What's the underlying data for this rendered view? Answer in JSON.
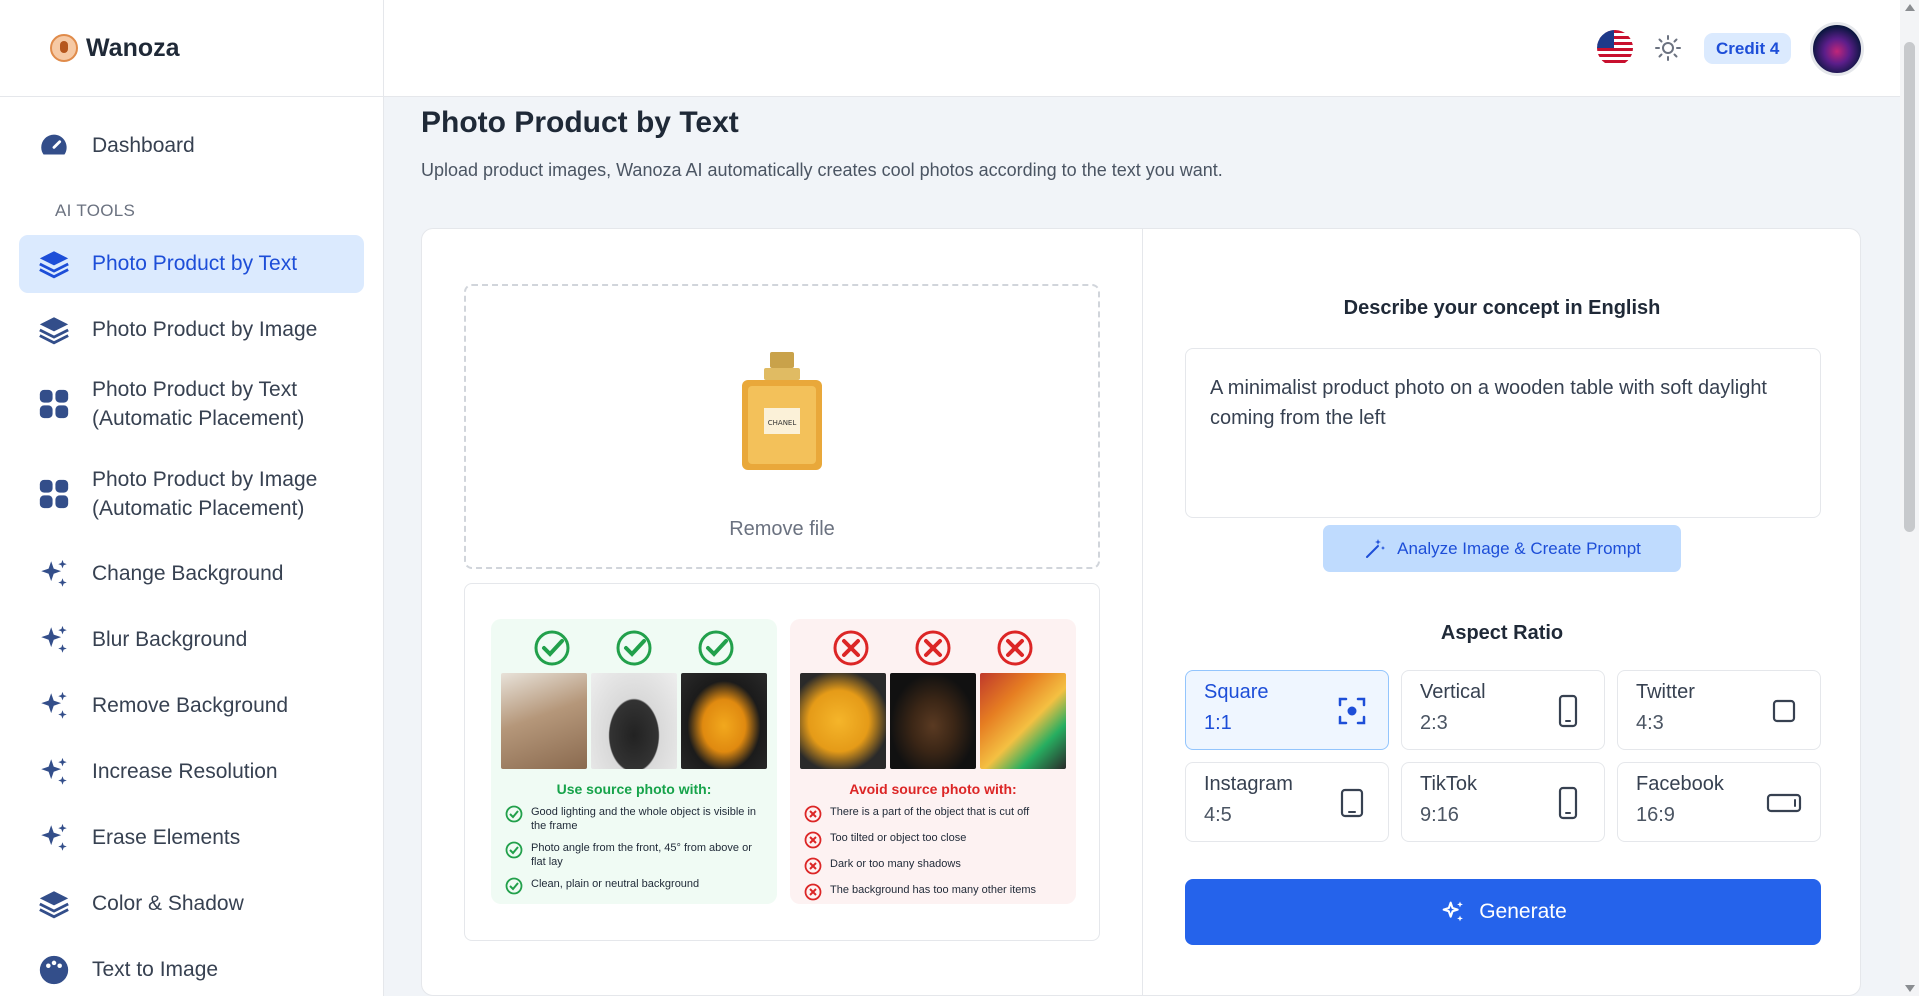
{
  "brand": {
    "name": "Wanoza"
  },
  "sidebar": {
    "dashboard_label": "Dashboard",
    "section_label": "AI TOOLS",
    "items": [
      {
        "label": "Photo Product by Text",
        "icon": "layers-icon"
      },
      {
        "label": "Photo Product by Image",
        "icon": "layers-icon"
      },
      {
        "label_line1": "Photo Product by Text",
        "label_line2": "(Automatic Placement)",
        "icon": "grid-icon"
      },
      {
        "label_line1": "Photo Product by Image",
        "label_line2": "(Automatic Placement)",
        "icon": "grid-icon"
      },
      {
        "label": "Change Background",
        "icon": "sparkles-icon"
      },
      {
        "label": "Blur Background",
        "icon": "sparkles-icon"
      },
      {
        "label": "Remove Background",
        "icon": "sparkles-icon"
      },
      {
        "label": "Increase Resolution",
        "icon": "sparkles-icon"
      },
      {
        "label": "Erase Elements",
        "icon": "sparkles-icon"
      },
      {
        "label": "Color & Shadow",
        "icon": "layers-icon"
      },
      {
        "label": "Text to Image",
        "icon": "palette-icon"
      }
    ]
  },
  "header": {
    "credit_label": "Credit 4"
  },
  "main": {
    "title": "Photo Product by Text",
    "subtitle": "Upload product images, Wanoza AI automatically creates cool photos according to the text you want.",
    "upload": {
      "remove_file_label": "Remove file",
      "bottle_label": "CHANEL"
    },
    "guide": {
      "good_title": "Use source photo with:",
      "good_items": [
        "Good lighting and the whole object is visible in the frame",
        "Photo angle from the front, 45° from above or flat lay",
        "Clean, plain or neutral background"
      ],
      "bad_title": "Avoid source photo with:",
      "bad_items": [
        "There is a part of the object that is cut off",
        "Too tilted or object too close",
        "Dark or too many shadows",
        "The background has too many other items"
      ]
    },
    "concept": {
      "title": "Describe your concept in English",
      "value": "A minimalist product photo on a wooden table with soft daylight coming from the left"
    },
    "analyze_label": "Analyze Image & Create Prompt",
    "aspect_title": "Aspect Ratio",
    "ratios": [
      {
        "name": "Square",
        "value": "1:1",
        "icon": "focus-icon",
        "selected": true
      },
      {
        "name": "Vertical",
        "value": "2:3",
        "icon": "phone-icon",
        "selected": false
      },
      {
        "name": "Twitter",
        "value": "4:3",
        "icon": "square-icon",
        "selected": false
      },
      {
        "name": "Instagram",
        "value": "4:5",
        "icon": "portrait-icon",
        "selected": false
      },
      {
        "name": "TikTok",
        "value": "9:16",
        "icon": "phone-icon",
        "selected": false
      },
      {
        "name": "Facebook",
        "value": "16:9",
        "icon": "landscape-icon",
        "selected": false
      }
    ],
    "generate_label": "Generate"
  },
  "colors": {
    "accent": "#2563eb",
    "active_bg": "#dbeafe",
    "icon": "#334e8a"
  }
}
